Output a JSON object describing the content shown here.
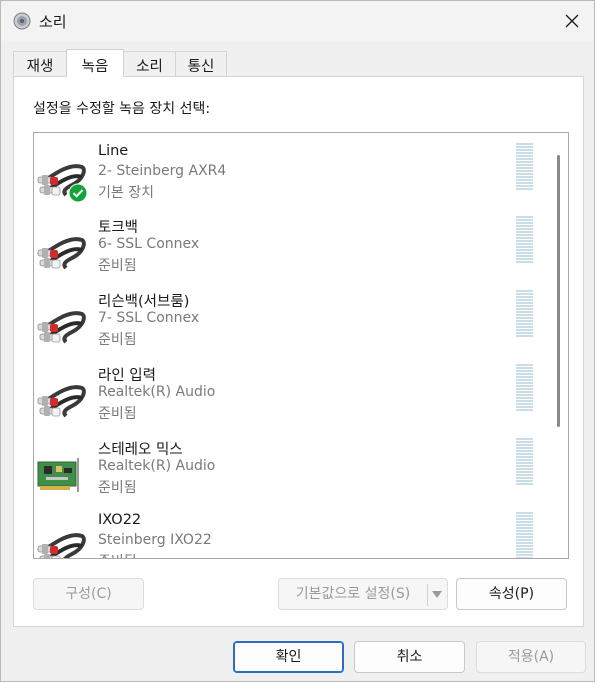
{
  "window": {
    "title": "소리"
  },
  "tabs": [
    {
      "label": "재생"
    },
    {
      "label": "녹음"
    },
    {
      "label": "소리"
    },
    {
      "label": "통신"
    }
  ],
  "instruction": "설정을 수정할 녹음 장치 선택:",
  "devices": [
    {
      "name": "Line",
      "description": "2- Steinberg AXR4",
      "status": "기본 장치",
      "icon": "rca-cable-icon",
      "default": true
    },
    {
      "name": "토크백",
      "description": "6- SSL Connex",
      "status": "준비됨",
      "icon": "rca-cable-icon"
    },
    {
      "name": "리슨백(서브룸)",
      "description": "7- SSL Connex",
      "status": "준비됨",
      "icon": "rca-cable-icon"
    },
    {
      "name": "라인 입력",
      "description": "Realtek(R) Audio",
      "status": "준비됨",
      "icon": "rca-cable-icon"
    },
    {
      "name": "스테레오 믹스",
      "description": "Realtek(R) Audio",
      "status": "준비됨",
      "icon": "sound-card-icon"
    },
    {
      "name": "IXO22",
      "description": "Steinberg IXO22",
      "status": "준비됨",
      "icon": "rca-cable-icon"
    }
  ],
  "buttons": {
    "configure": "구성(C)",
    "set_default": "기본값으로 설정(S)",
    "properties": "속성(P)",
    "ok": "확인",
    "cancel": "취소",
    "apply": "적용(A)"
  },
  "colors": {
    "accent": "#2b6cc4",
    "check": "#12a33a",
    "meter": "#c8dde6"
  }
}
